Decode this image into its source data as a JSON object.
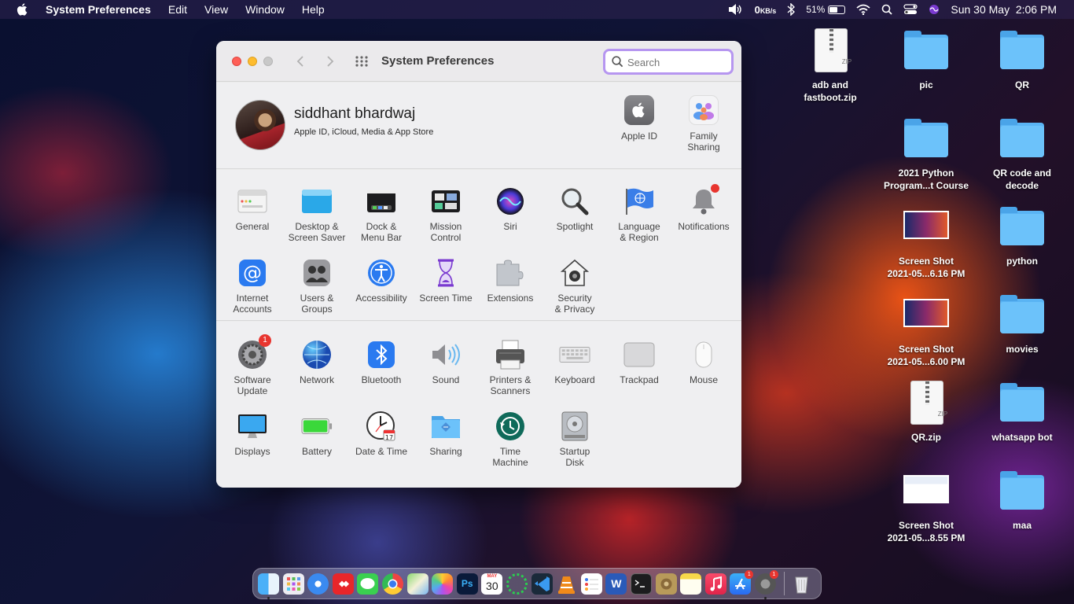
{
  "menubar": {
    "app_name": "System Preferences",
    "menus": [
      "Edit",
      "View",
      "Window",
      "Help"
    ],
    "net_speed": "0",
    "net_unit": "KB/s",
    "battery_percent": "51%",
    "battery_level": 0.51,
    "datetime": "Sun 30 May  2:06 PM"
  },
  "window": {
    "title": "System Preferences",
    "search_placeholder": "Search"
  },
  "account": {
    "name": "siddhant bhardwaj",
    "subtitle": "Apple ID, iCloud, Media & App Store",
    "apple_id_label": "Apple ID",
    "family_line1": "Family",
    "family_line2": "Sharing"
  },
  "panes": {
    "general": [
      "General",
      ""
    ],
    "desktop": [
      "Desktop &",
      "Screen Saver"
    ],
    "dock": [
      "Dock &",
      "Menu Bar"
    ],
    "mission": [
      "Mission",
      "Control"
    ],
    "siri": [
      "Siri",
      ""
    ],
    "spotlight": [
      "Spotlight",
      ""
    ],
    "language": [
      "Language",
      "& Region"
    ],
    "notifications": [
      "Notifications",
      ""
    ],
    "internet": [
      "Internet",
      "Accounts"
    ],
    "users": [
      "Users &",
      "Groups"
    ],
    "accessibility": [
      "Accessibility",
      ""
    ],
    "screentime": [
      "Screen Time",
      ""
    ],
    "extensions": [
      "Extensions",
      ""
    ],
    "security": [
      "Security",
      "& Privacy"
    ],
    "softwareupdate": [
      "Software",
      "Update"
    ],
    "network": [
      "Network",
      ""
    ],
    "bluetooth": [
      "Bluetooth",
      ""
    ],
    "sound": [
      "Sound",
      ""
    ],
    "printers": [
      "Printers &",
      "Scanners"
    ],
    "keyboard": [
      "Keyboard",
      ""
    ],
    "trackpad": [
      "Trackpad",
      ""
    ],
    "mouse": [
      "Mouse",
      ""
    ],
    "displays": [
      "Displays",
      ""
    ],
    "battery": [
      "Battery",
      ""
    ],
    "datetime": [
      "Date & Time",
      ""
    ],
    "sharing": [
      "Sharing",
      ""
    ],
    "timemachine": [
      "Time",
      "Machine"
    ],
    "startup": [
      "Startup",
      "Disk"
    ]
  },
  "badges": {
    "software_update": "1",
    "calendar_day": "30",
    "calendar_month": "MAY",
    "dock_appstore": "1",
    "dock_sysprefs": "1",
    "datetime_day": "17"
  },
  "desktop": {
    "adb": [
      "adb and",
      "fastboot.zip"
    ],
    "pic": [
      "pic",
      ""
    ],
    "qr": [
      "QR",
      ""
    ],
    "python_course": [
      "2021 Python",
      "Program...t Course"
    ],
    "qr_code": [
      "QR code and",
      "decode"
    ],
    "shot1": [
      "Screen Shot",
      "2021-05...6.16 PM"
    ],
    "python": [
      "python",
      ""
    ],
    "shot2": [
      "Screen Shot",
      "2021-05...6.00 PM"
    ],
    "movies": [
      "movies",
      ""
    ],
    "qrzip": [
      "QR.zip",
      ""
    ],
    "whatsapp": [
      "whatsapp bot",
      ""
    ],
    "shot3": [
      "Screen Shot",
      "2021-05...8.55 PM"
    ],
    "maa": [
      "maa",
      ""
    ],
    "zip_label": "ZIP"
  },
  "colors": {
    "accent": "#b696f0",
    "close": "#fe5f57",
    "minimize": "#febc2e",
    "badge": "#e8352f",
    "folder": "#5ab4f4"
  },
  "dock_apps": [
    "finder-icon",
    "launchpad-icon",
    "safari-icon",
    "anydesk-icon",
    "messages-icon",
    "chrome-icon",
    "maps-icon",
    "photos-icon",
    "photoshop-icon",
    "calendar-icon",
    "circle-app-icon",
    "vscode-icon",
    "vlc-icon",
    "reminders-icon",
    "word-icon",
    "terminal-icon",
    "archive-icon",
    "notes-icon",
    "music-icon",
    "appstore-icon",
    "system-preferences-icon",
    "trash-icon"
  ]
}
